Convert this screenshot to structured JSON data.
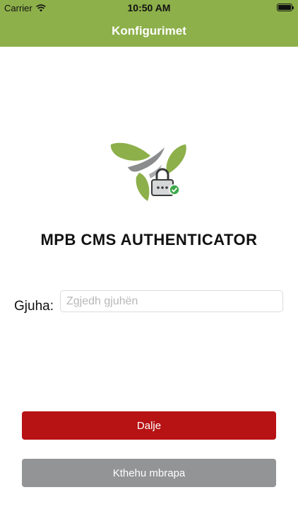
{
  "status_bar": {
    "carrier": "Carrier",
    "time": "10:50 AM",
    "battery_level": 1.0
  },
  "nav": {
    "title": "Konfigurimet"
  },
  "app": {
    "title": "MPB CMS AUTHENTICATOR"
  },
  "language": {
    "label": "Gjuha:",
    "value": "",
    "placeholder": "Zgjedh gjuhën"
  },
  "buttons": {
    "exit_label": "Dalje",
    "back_label": "Kthehu mbrapa"
  },
  "colors": {
    "brand_green": "#8db04a",
    "exit_red": "#b71214",
    "back_gray": "#929496"
  }
}
